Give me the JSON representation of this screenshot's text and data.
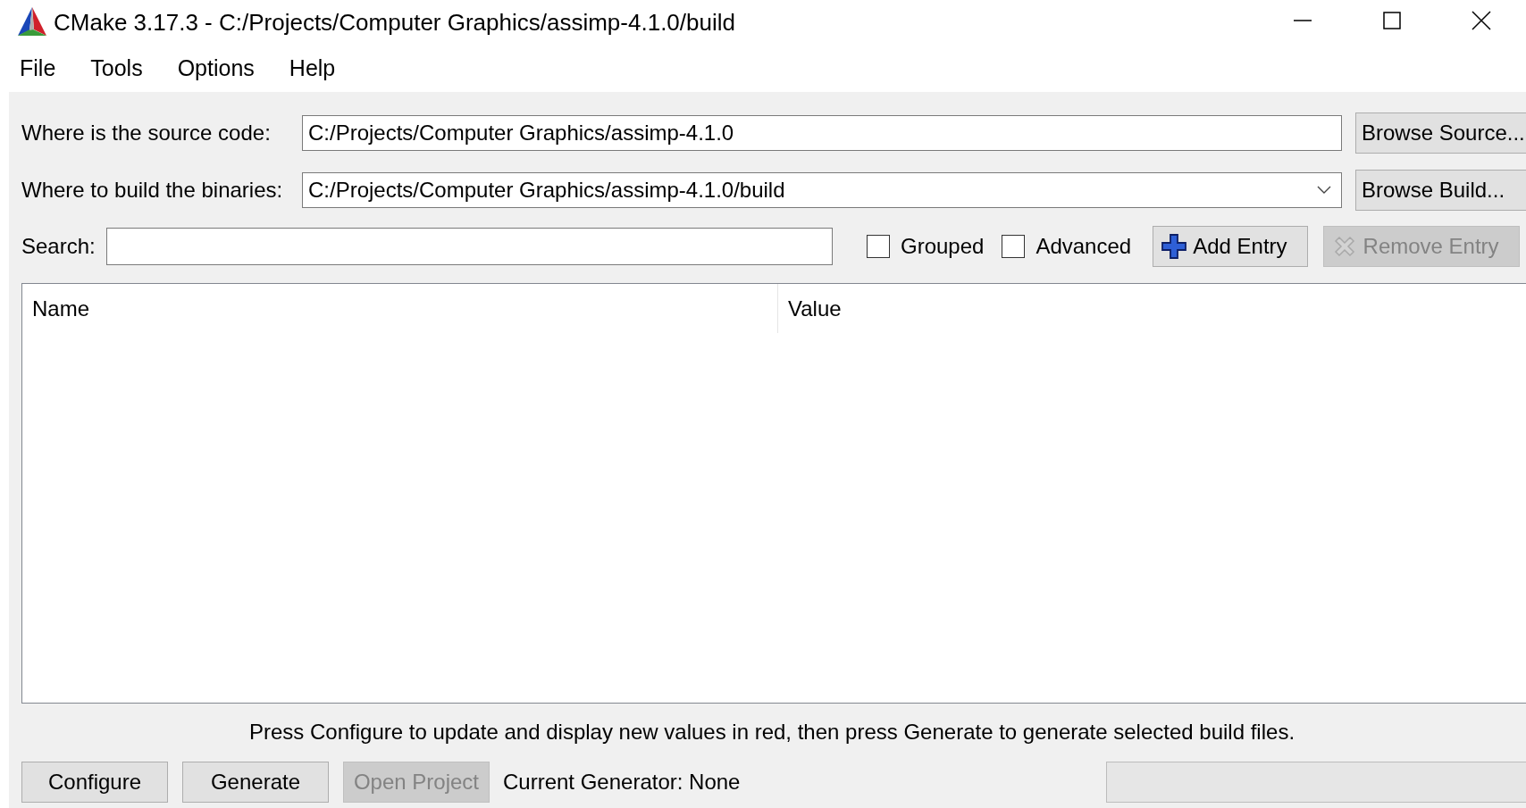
{
  "window": {
    "title": "CMake 3.17.3 - C:/Projects/Computer Graphics/assimp-4.1.0/build"
  },
  "menu": [
    "File",
    "Tools",
    "Options",
    "Help"
  ],
  "source": {
    "label": "Where is the source code:",
    "value": "C:/Projects/Computer Graphics/assimp-4.1.0",
    "button": "Browse Source..."
  },
  "build": {
    "label": "Where to build the binaries:",
    "value": "C:/Projects/Computer Graphics/assimp-4.1.0/build",
    "button": "Browse Build..."
  },
  "search": {
    "label": "Search:"
  },
  "options": [
    {
      "label": "Grouped",
      "checked": false
    },
    {
      "label": "Advanced",
      "checked": false
    }
  ],
  "entry_buttons": [
    {
      "label": "Add Entry",
      "kind": "add",
      "disabled": false
    },
    {
      "label": "Remove Entry",
      "kind": "remove",
      "disabled": true
    }
  ],
  "table": {
    "columns": [
      "Name",
      "Value"
    ]
  },
  "message": "Press Configure to update and display new values in red, then press Generate to generate selected build files.",
  "actions": [
    {
      "label": "Configure",
      "disabled": false
    },
    {
      "label": "Generate",
      "disabled": false
    },
    {
      "label": "Open Project",
      "disabled": true
    }
  ],
  "generator": "Current Generator: None"
}
